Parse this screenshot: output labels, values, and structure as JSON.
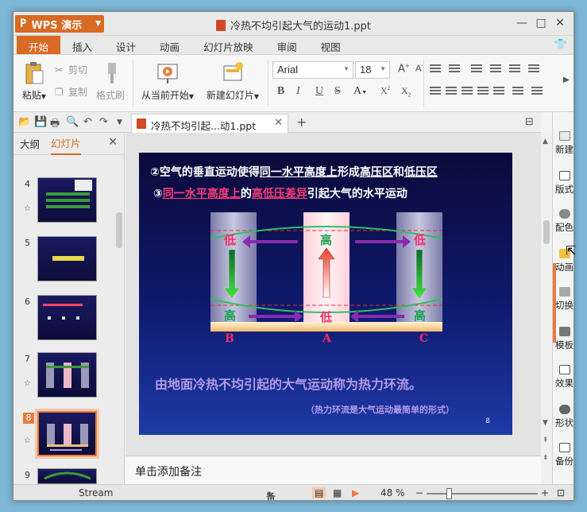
{
  "app": {
    "name": "WPS 演示",
    "doc_title": "冷热不均引起大气的运动1.ppt"
  },
  "tabs": [
    "开始",
    "插入",
    "设计",
    "动画",
    "幻灯片放映",
    "审阅",
    "视图"
  ],
  "ribbon": {
    "paste": "粘贴",
    "cut": "剪切",
    "copy": "复制",
    "format_painter": "格式刷",
    "from_current": "从当前开始",
    "new_slide": "新建幻灯片",
    "font_name": "Arial",
    "font_size": "18"
  },
  "doc_tab": {
    "label": "冷热不均引起...动1.ppt"
  },
  "left_panel": {
    "tab_outline": "大纲",
    "tab_slides": "幻灯片",
    "slides": [
      {
        "num": "4",
        "star": true
      },
      {
        "num": "5",
        "star": false
      },
      {
        "num": "6",
        "star": false
      },
      {
        "num": "7",
        "star": true
      },
      {
        "num": "8",
        "star": true,
        "selected": true
      },
      {
        "num": "9",
        "star": true
      }
    ]
  },
  "slide": {
    "line1_a": "②空气的垂直运动使得",
    "line1_b": "同一水平高度上",
    "line1_c": "形成",
    "line1_d": "高压区",
    "line1_e": "和",
    "line1_f": "低压区",
    "line2_a": "③",
    "line2_b": "同一水平高度上",
    "line2_c": "的",
    "line2_d": "高低压差异",
    "line2_e": "引起大气的水平运动",
    "top_left": "低",
    "top_mid": "高",
    "top_right": "低",
    "bot_left": "高",
    "bot_mid": "低",
    "bot_right": "高",
    "label_b": "B",
    "label_a": "A",
    "label_c": "C",
    "caption": "由地面冷热不均引起的大气运动称为热力环流。",
    "note": "（热力环流是大气运动最简单的形式）",
    "page": "8"
  },
  "notes_placeholder": "单击添加备注",
  "right_panel": [
    "新建",
    "版式",
    "配色",
    "动画",
    "切换",
    "模板",
    "效果",
    "形状",
    "备份"
  ],
  "status": {
    "theme": "Stream",
    "notes": "备注",
    "zoom": "48 %"
  }
}
